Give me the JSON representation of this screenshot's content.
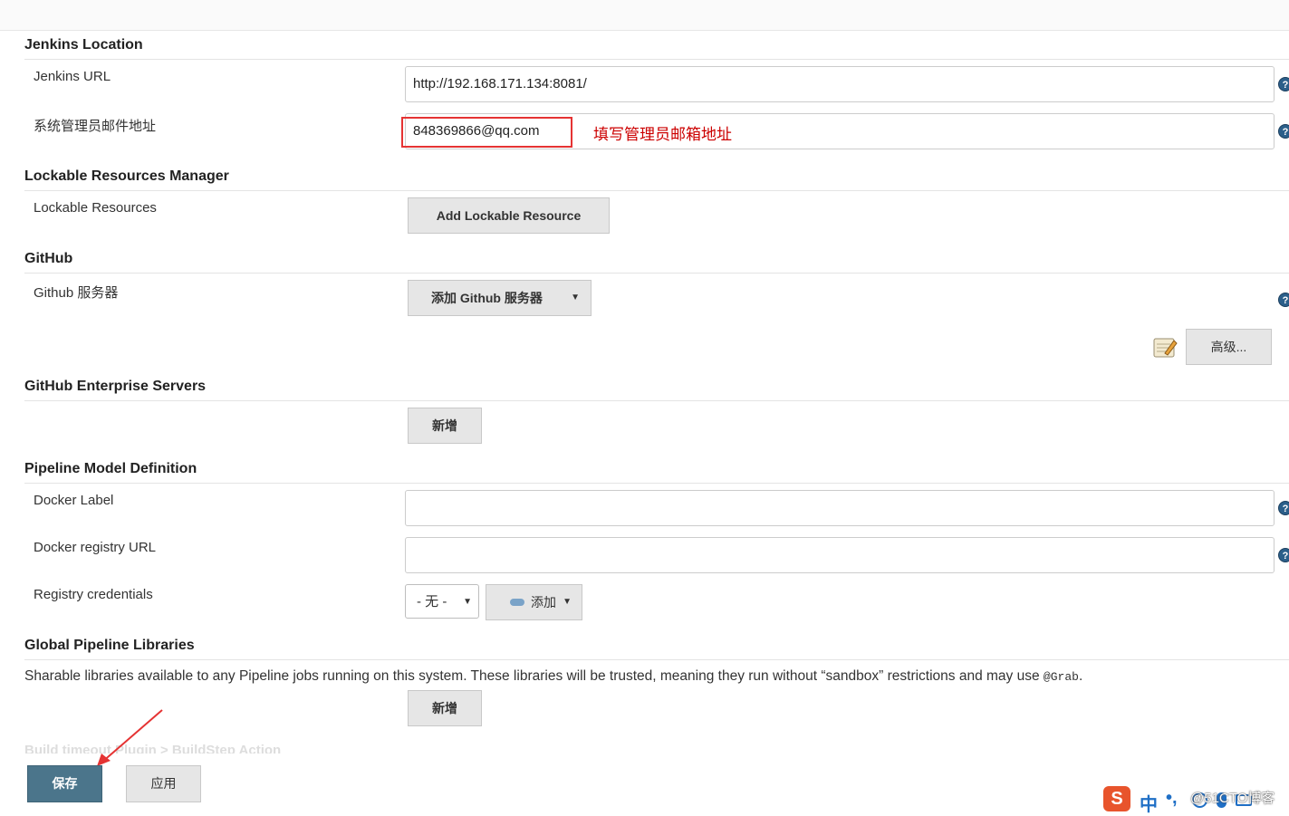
{
  "sections": {
    "jenkins_location": {
      "title": "Jenkins Location",
      "url_label": "Jenkins URL",
      "url_value": "http://192.168.171.134:8081/",
      "email_label": "系统管理员邮件地址",
      "email_value": "848369866@qq.com",
      "email_note": "填写管理员邮箱地址"
    },
    "lockable": {
      "title": "Lockable Resources Manager",
      "label": "Lockable Resources",
      "button": "Add Lockable Resource"
    },
    "github": {
      "title": "GitHub",
      "label": "Github 服务器",
      "button": "添加 Github 服务器",
      "advanced_button": "高级..."
    },
    "github_enterprise": {
      "title": "GitHub Enterprise Servers",
      "button": "新增"
    },
    "pipeline_model": {
      "title": "Pipeline Model Definition",
      "docker_label": "Docker Label",
      "registry_url_label": "Docker registry URL",
      "credentials_label": "Registry credentials",
      "credentials_selected": "- 无 -",
      "add_button": "添加"
    },
    "global_libraries": {
      "title": "Global Pipeline Libraries",
      "description": "Sharable libraries available to any Pipeline jobs running on this system. These libraries will be trusted, meaning they run without “sandbox” restrictions and may use",
      "description_code": "@Grab",
      "description_end": ".",
      "button": "新增"
    },
    "faded_section": {
      "title": "Build timeout Plugin > BuildStep Action"
    }
  },
  "footer": {
    "save": "保存",
    "apply": "应用"
  },
  "ime": {
    "logo": "S",
    "lang": "中",
    "punct": "•,"
  },
  "watermark": "@51CTO博客",
  "colors": {
    "save_button": "#4b758b",
    "annotation": "#e53333",
    "help_icon": "#2c5f8a"
  }
}
